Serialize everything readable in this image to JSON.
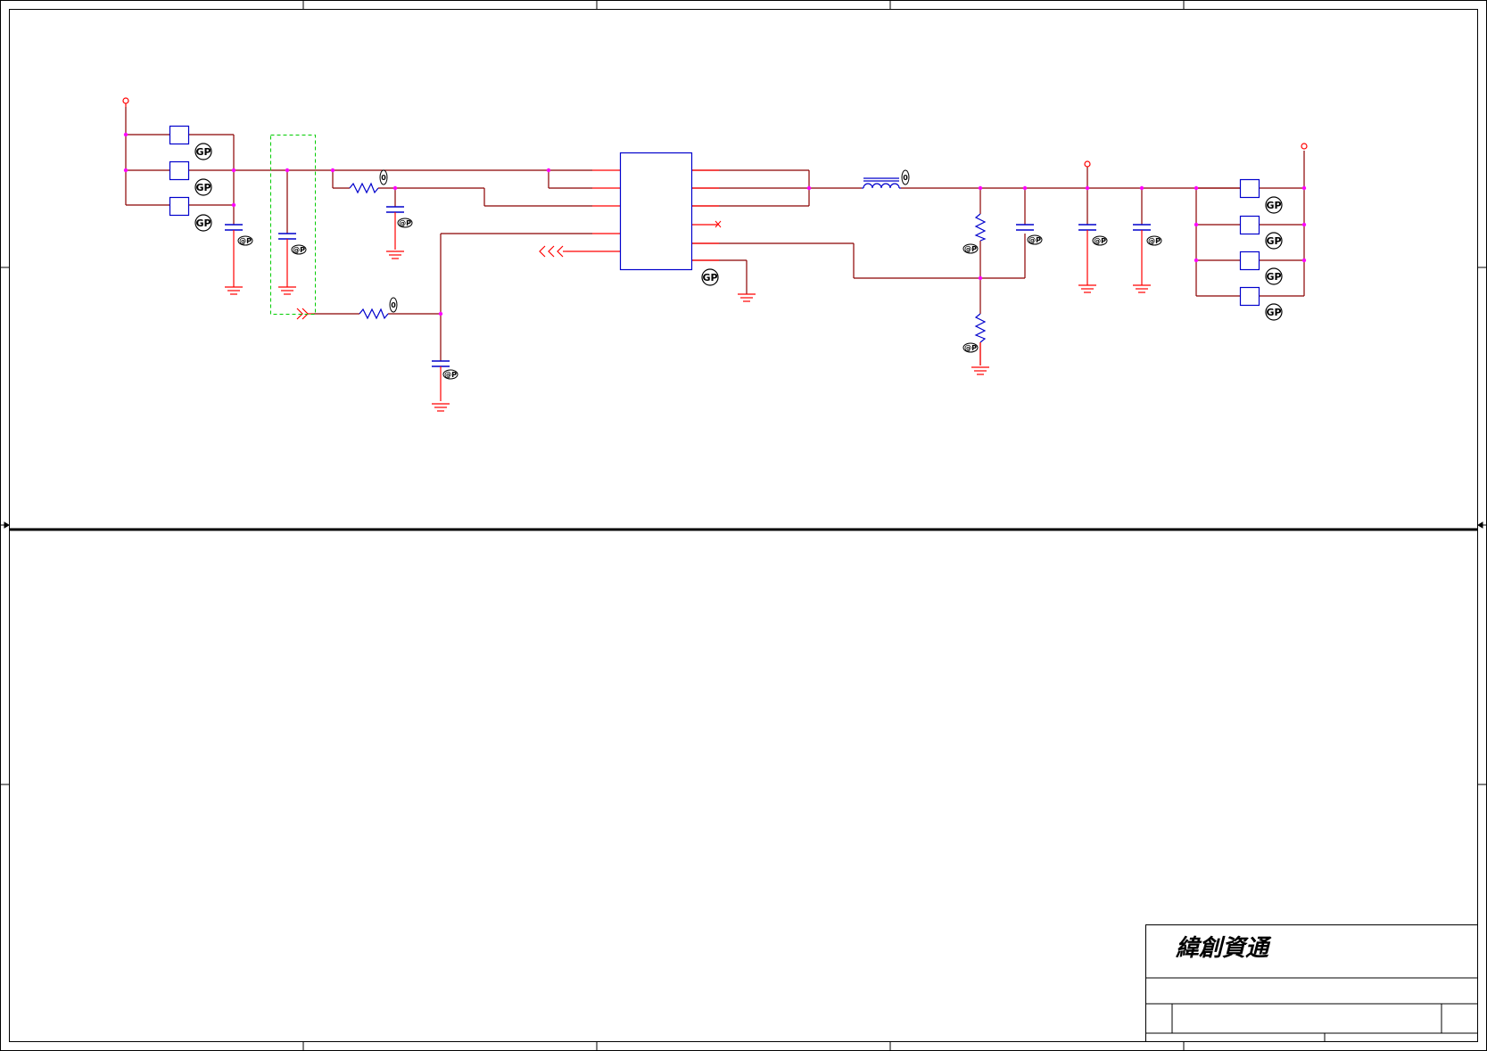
{
  "title_block": {
    "company_name": "緯創資通"
  },
  "badges": {
    "gp": "GP",
    "cap_mark": "@P",
    "small_mark": "0"
  },
  "colors": {
    "wire": "#8b0000",
    "pin": "#ff0000",
    "component": "#0000cc",
    "junction": "#ff00ff",
    "keepout": "#00cc00",
    "frame": "#000000"
  }
}
